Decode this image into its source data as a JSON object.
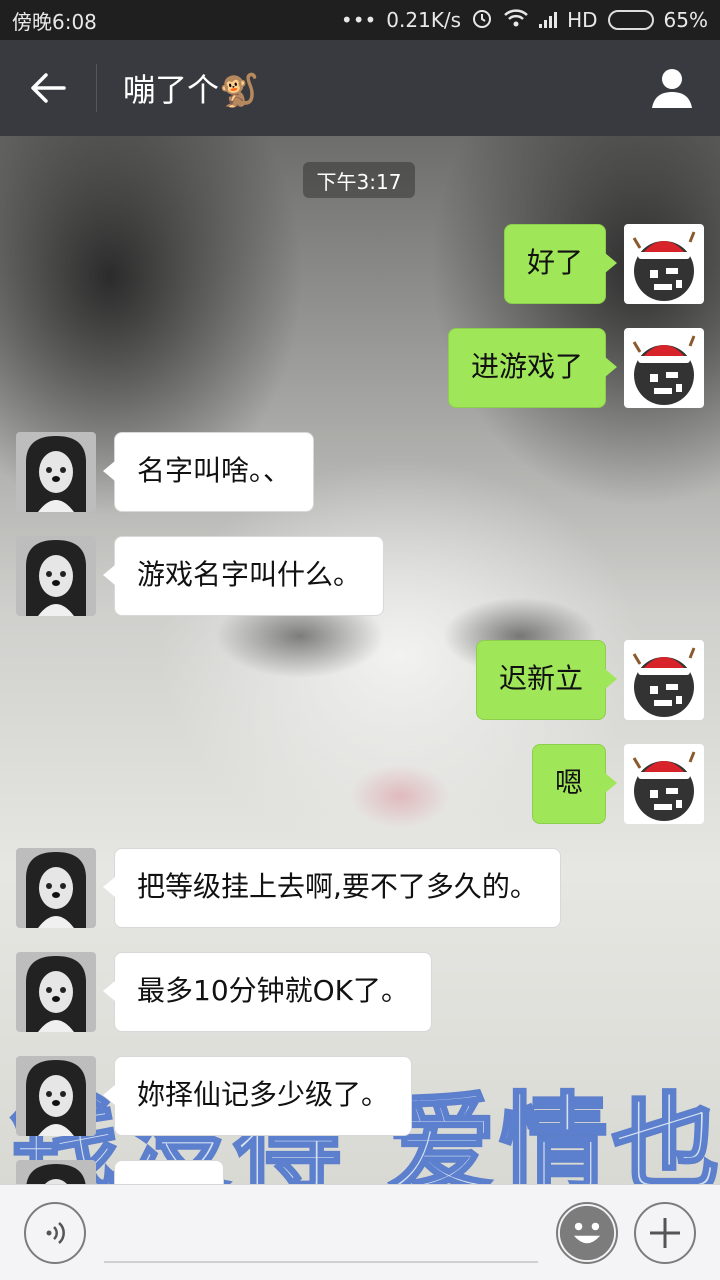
{
  "status_bar": {
    "time": "傍晚6:08",
    "dots": "•••",
    "speed": "0.21K/s",
    "network": "HD",
    "battery": "65%",
    "battery_level": 0.65
  },
  "header": {
    "title": "嘣了个🐒"
  },
  "chat": {
    "timestamp": "下午3:17",
    "background_text_line1": "",
    "background_text_line2": "钱没得 爱情也没",
    "messages": [
      {
        "side": "out",
        "text": "好了"
      },
      {
        "side": "out",
        "text": "进游戏了"
      },
      {
        "side": "in",
        "text": "名字叫啥。、"
      },
      {
        "side": "in",
        "text": "游戏名字叫什么。"
      },
      {
        "side": "out",
        "text": "迟新立"
      },
      {
        "side": "out",
        "text": "嗯"
      },
      {
        "side": "in",
        "text": "把等级挂上去啊,要不了多久的。"
      },
      {
        "side": "in",
        "text": "最多10分钟就OK了。"
      },
      {
        "side": "in",
        "text": "妳择仙记多少级了。"
      },
      {
        "side": "in",
        "text": ""
      }
    ]
  },
  "input_bar": {
    "voice_icon": "voice-icon",
    "emoji_icon": "emoji-icon",
    "plus_icon": "plus-icon"
  },
  "colors": {
    "title_bar": "#393a3f",
    "status_bar": "#1f1f1f",
    "bubble_out": "#9fe659",
    "bubble_in": "#ffffff"
  }
}
